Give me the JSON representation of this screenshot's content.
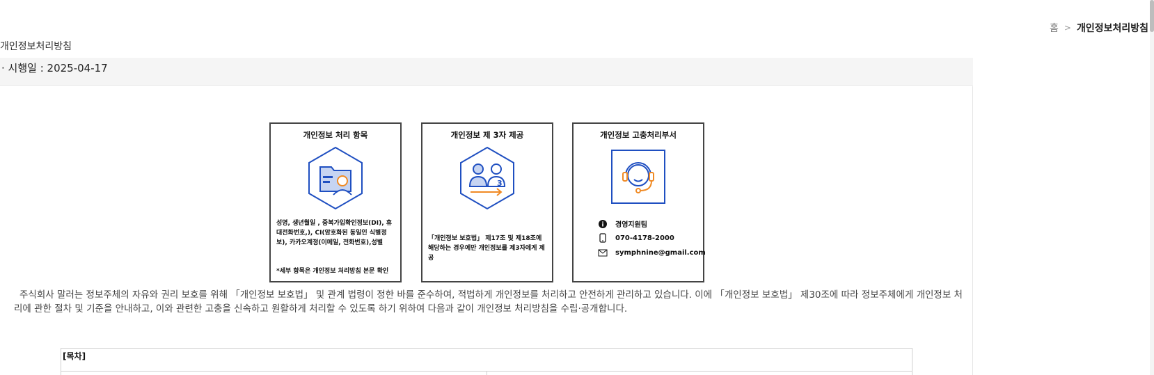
{
  "breadcrumb": {
    "home": "홈",
    "separator": ">",
    "current": "개인정보처리방침"
  },
  "page_title": "개인정보처리방침",
  "effective_date": "· 시행일 : 2025-04-17",
  "cards": [
    {
      "title": "개인정보 처리 항목",
      "icon": "folder-person-hexagon-icon",
      "desc": "성명, 생년월일 , 중복가입확인정보(DI), 휴대전화번호,), CI(암호화된 동일인 식별정보), 카카오계정(이메일, 전화번호),성별",
      "note": "*세부 항목은 개인정보 처리방침 본문 확인"
    },
    {
      "title": "개인정보 제 3자 제공",
      "icon": "third-party-hexagon-icon",
      "desc": "「개인정보 보호법」 제17조 및 제18조에 해당하는 경우에만 개인정보를 제3자에게 제공"
    },
    {
      "title": "개인정보 고충처리부서",
      "icon": "headset-support-icon",
      "contacts": [
        {
          "icon": "info-icon",
          "text": "경영지원팀"
        },
        {
          "icon": "phone-icon",
          "text": "070-4178-2000"
        },
        {
          "icon": "mail-icon",
          "text": "symphnine@gmail.com"
        }
      ]
    }
  ],
  "intro": "주식회사 말러는 정보주체의 자유와 권리 보호를 위해 「개인정보 보호법」 및 관계 법령이 정한 바를 준수하여, 적법하게 개인정보를 처리하고 안전하게 관리하고 있습니다. 이에 「개인정보 보호법」 제30조에 따라 정보주체에게 개인정보 처리에 관한 절차 및 기준을 안내하고, 이와 관련한 고충을 신속하고 원활하게 처리할 수 있도록 하기 위하여 다음과 같이 개인정보 처리방침을 수립·공개합니다.",
  "toc": {
    "title": "[목차]"
  },
  "colors": {
    "icon_blue": "#1f4fc1",
    "icon_light_blue": "#c6d4f2",
    "icon_orange": "#f08a24"
  }
}
